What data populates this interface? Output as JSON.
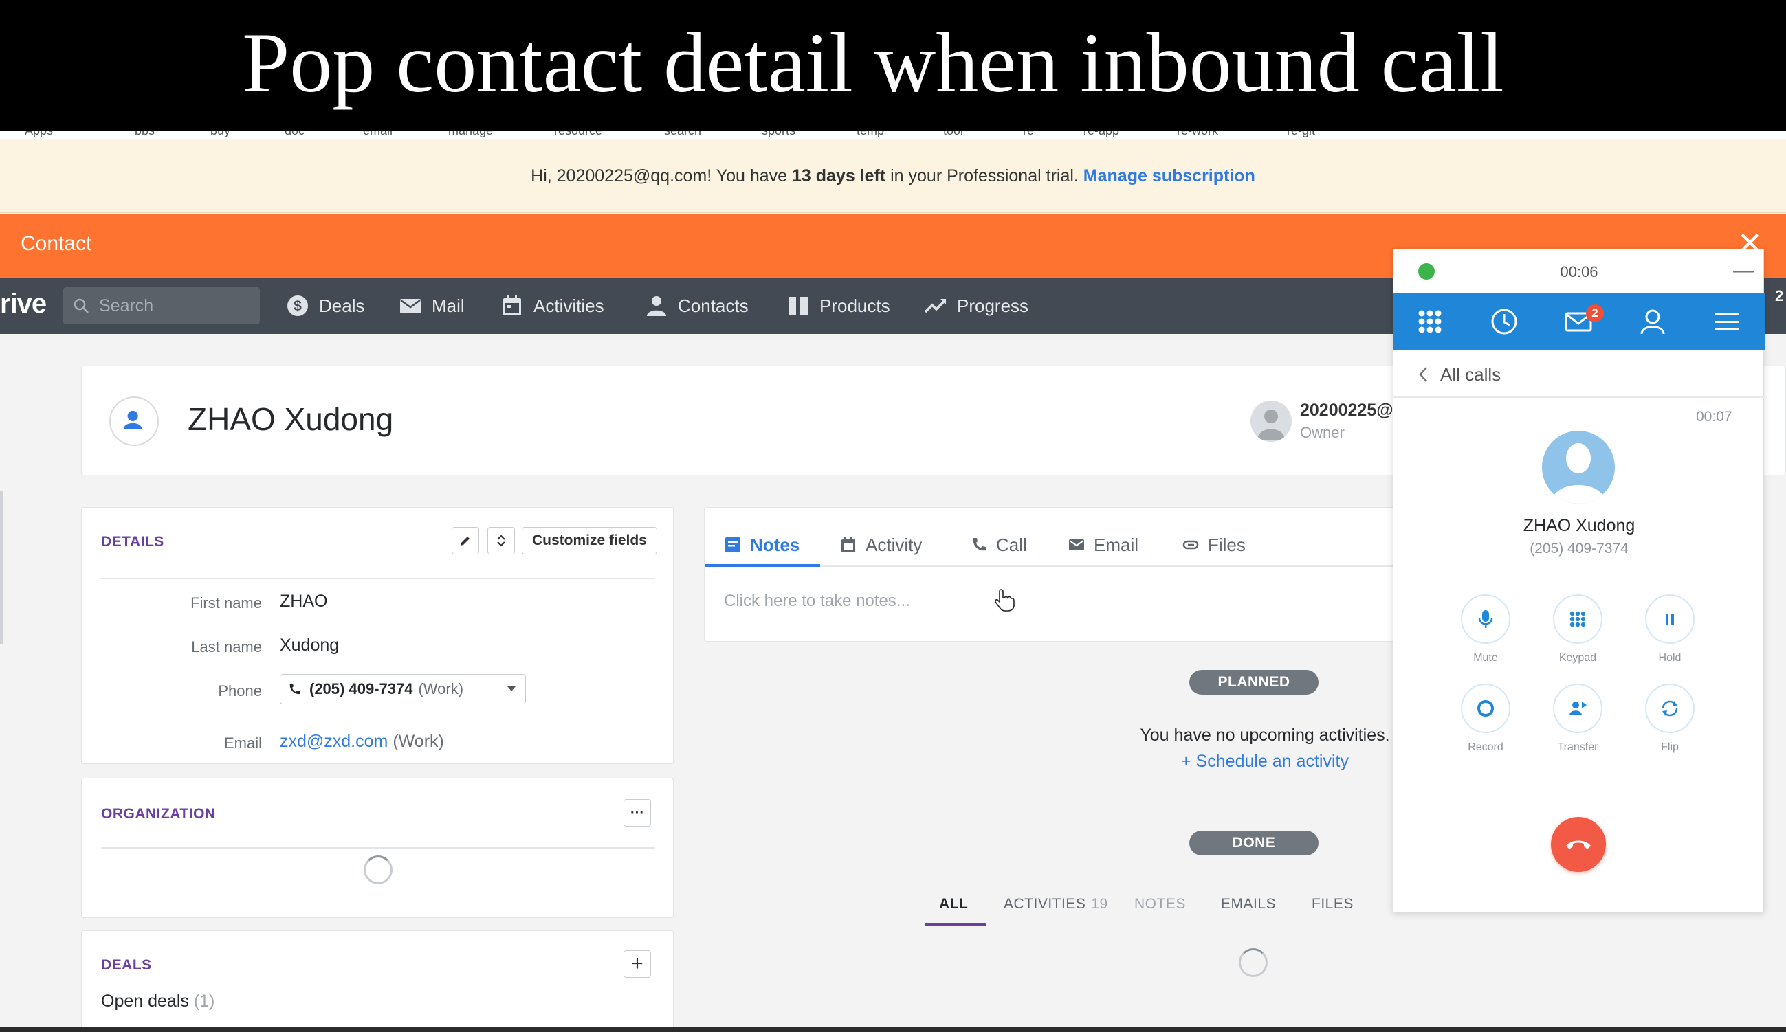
{
  "banner": {
    "title": "Pop contact detail when inbound call"
  },
  "bookmarks": [
    "Apps",
    "bbs",
    "buy",
    "doc",
    "email",
    "manage",
    "resource",
    "search",
    "sports",
    "temp",
    "tool",
    "re",
    "re-app",
    "re-work",
    "re-git"
  ],
  "trial": {
    "prefix": "Hi, 20200225@qq.com! You have ",
    "days": "13 days left",
    "suffix": " in your Professional trial. ",
    "link": "Manage subscription"
  },
  "contact_bar": {
    "title": "Contact",
    "close": "✕"
  },
  "nav": {
    "logo_fragment": "rive",
    "search_placeholder": "Search",
    "items": [
      {
        "label": "Deals",
        "icon": "dollar-icon"
      },
      {
        "label": "Mail",
        "icon": "mail-icon"
      },
      {
        "label": "Activities",
        "icon": "calendar-icon"
      },
      {
        "label": "Contacts",
        "icon": "person-icon"
      },
      {
        "label": "Products",
        "icon": "box-icon"
      },
      {
        "label": "Progress",
        "icon": "trend-icon"
      }
    ],
    "right_fragment": "2"
  },
  "profile": {
    "name": "ZHAO Xudong",
    "owner_name": "20200225@",
    "owner_role": "Owner"
  },
  "details": {
    "title": "DETAILS",
    "customize_label": "Customize fields",
    "fields": {
      "first_name_label": "First name",
      "first_name": "ZHAO",
      "last_name_label": "Last name",
      "last_name": "Xudong",
      "phone_label": "Phone",
      "phone_number": "(205) 409-7374",
      "phone_type": "(Work)",
      "email_label": "Email",
      "email": "zxd@zxd.com",
      "email_type": "(Work)"
    }
  },
  "organization": {
    "title": "ORGANIZATION",
    "more": "···"
  },
  "deals": {
    "title": "DEALS",
    "open_label": "Open deals",
    "open_count": "(1)",
    "add": "+"
  },
  "notes_panel": {
    "tabs": [
      "Notes",
      "Activity",
      "Call",
      "Email",
      "Files"
    ],
    "placeholder": "Click here to take notes..."
  },
  "timeline": {
    "planned": "PLANNED",
    "no_activities": "You have no upcoming activities.",
    "schedule_link": "+ Schedule an activity",
    "done": "DONE",
    "filters": [
      {
        "label": "ALL",
        "count": ""
      },
      {
        "label": "ACTIVITIES",
        "count": "19"
      },
      {
        "label": "NOTES",
        "count": ""
      },
      {
        "label": "EMAILS",
        "count": ""
      },
      {
        "label": "FILES",
        "count": ""
      }
    ]
  },
  "dialer": {
    "timer": "00:06",
    "minimize": "—",
    "badge_count": "2",
    "back_label": "All calls",
    "call_duration": "00:07",
    "caller_name": "ZHAO Xudong",
    "caller_number": "(205) 409-7374",
    "controls": [
      "Mute",
      "Keypad",
      "Hold",
      "Record",
      "Transfer",
      "Flip"
    ],
    "colors": {
      "toolbar": "#1f86d8",
      "hangup": "#f25a46",
      "status": "#3cb44b"
    }
  },
  "colors": {
    "contact_bar": "#ff7330",
    "navbar": "#434a53",
    "link": "#317ae2",
    "section_title": "#6b3fa0"
  }
}
